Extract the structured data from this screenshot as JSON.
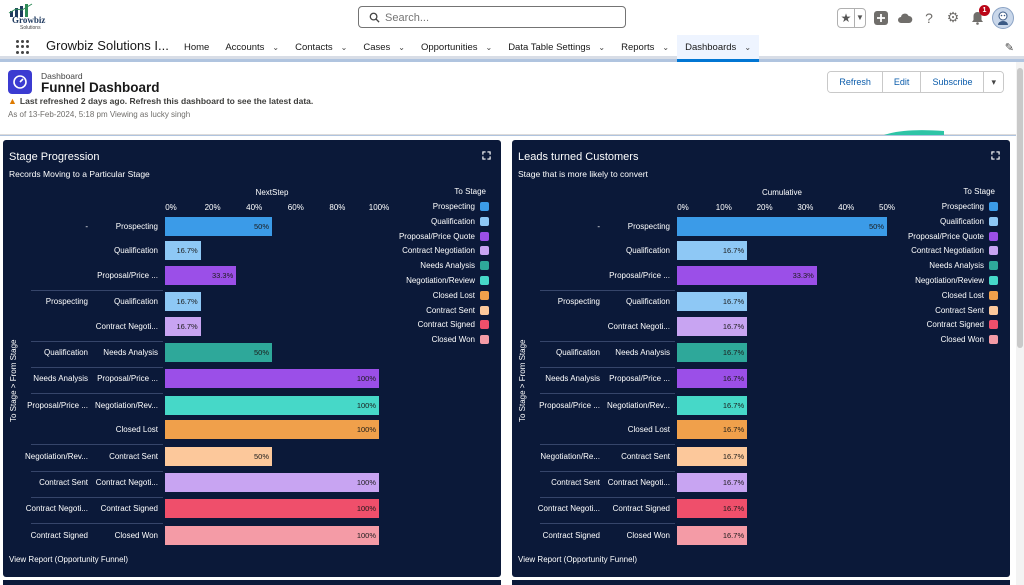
{
  "brand": {
    "logo_text": "Growbiz",
    "logo_sub": "Solutions"
  },
  "search": {
    "placeholder": "Search..."
  },
  "header_icons": {
    "notification_count": "1"
  },
  "nav": {
    "app_name": "Growbiz Solutions I...",
    "items": [
      {
        "label": "Home",
        "has_menu": false
      },
      {
        "label": "Accounts",
        "has_menu": true
      },
      {
        "label": "Contacts",
        "has_menu": true
      },
      {
        "label": "Cases",
        "has_menu": true
      },
      {
        "label": "Opportunities",
        "has_menu": true
      },
      {
        "label": "Data Table Settings",
        "has_menu": true
      },
      {
        "label": "Reports",
        "has_menu": true
      },
      {
        "label": "Dashboards",
        "has_menu": true,
        "active": true
      }
    ]
  },
  "dashboard": {
    "kind": "Dashboard",
    "title": "Funnel Dashboard",
    "warning": "Last refreshed 2 days ago. Refresh this dashboard to see the latest data.",
    "as_of": "As of 13-Feb-2024, 5:18 pm Viewing as lucky singh",
    "buttons": {
      "refresh": "Refresh",
      "edit": "Edit",
      "subscribe": "Subscribe"
    }
  },
  "colors": {
    "Prospecting": "#3b9be8",
    "Qualification": "#8ec8f5",
    "Proposal/Price Quote": "#9b4fe8",
    "Contract Negotiation": "#c8a4f2",
    "Needs Analysis": "#2ea89a",
    "Negotiation/Review": "#46d8c8",
    "Closed Lost": "#f0a04b",
    "Contract Sent": "#fcc89b",
    "Contract Signed": "#ef4f6b",
    "Closed Won": "#f49ba6"
  },
  "legend": {
    "title": "To Stage",
    "items": [
      "Prospecting",
      "Qualification",
      "Proposal/Price Quote",
      "Contract Negotiation",
      "Needs Analysis",
      "Negotiation/Review",
      "Closed Lost",
      "Contract Sent",
      "Contract Signed",
      "Closed Won"
    ]
  },
  "widgets": [
    {
      "title": "Stage Progression",
      "subtitle": "Records Moving to a Particular Stage",
      "footer": "View Report (Opportunity Funnel)",
      "chart_data": {
        "type": "bar",
        "orientation": "horizontal",
        "xlabel": "NextStep",
        "ylabel": "To Stage > From Stage",
        "xlim": [
          0,
          100
        ],
        "xticks": [
          "0%",
          "20%",
          "40%",
          "60%",
          "80%",
          "100%"
        ],
        "groups": [
          {
            "from": "-",
            "rows": [
              {
                "to": "Prospecting",
                "to_label": "Prospecting",
                "value": 50,
                "label": "50%"
              },
              {
                "to": "Qualification",
                "to_label": "Qualification",
                "value": 16.7,
                "label": "16.7%"
              },
              {
                "to": "Proposal/Price Quote",
                "to_label": "Proposal/Price ...",
                "value": 33.3,
                "label": "33.3%"
              }
            ]
          },
          {
            "from": "Prospecting",
            "rows": [
              {
                "to": "Qualification",
                "to_label": "Qualification",
                "value": 16.7,
                "label": "16.7%"
              },
              {
                "to": "Contract Negotiation",
                "to_label": "Contract Negoti...",
                "value": 16.7,
                "label": "16.7%"
              }
            ]
          },
          {
            "from": "Qualification",
            "rows": [
              {
                "to": "Needs Analysis",
                "to_label": "Needs Analysis",
                "value": 50,
                "label": "50%"
              }
            ]
          },
          {
            "from": "Needs Analysis",
            "rows": [
              {
                "to": "Proposal/Price Quote",
                "to_label": "Proposal/Price ...",
                "value": 100,
                "label": "100%"
              }
            ]
          },
          {
            "from": "Proposal/Price ...",
            "rows": [
              {
                "to": "Negotiation/Review",
                "to_label": "Negotiation/Rev...",
                "value": 100,
                "label": "100%"
              },
              {
                "to": "Closed Lost",
                "to_label": "Closed Lost",
                "value": 100,
                "label": "100%"
              }
            ]
          },
          {
            "from": "Negotiation/Rev...",
            "rows": [
              {
                "to": "Contract Sent",
                "to_label": "Contract Sent",
                "value": 50,
                "label": "50%"
              }
            ]
          },
          {
            "from": "Contract Sent",
            "rows": [
              {
                "to": "Contract Negotiation",
                "to_label": "Contract Negoti...",
                "value": 100,
                "label": "100%"
              }
            ]
          },
          {
            "from": "Contract Negoti...",
            "rows": [
              {
                "to": "Contract Signed",
                "to_label": "Contract Signed",
                "value": 100,
                "label": "100%"
              }
            ]
          },
          {
            "from": "Contract Signed",
            "rows": [
              {
                "to": "Closed Won",
                "to_label": "Closed Won",
                "value": 100,
                "label": "100%"
              }
            ]
          }
        ]
      }
    },
    {
      "title": "Leads turned Customers",
      "subtitle": "Stage that is more likely to convert",
      "footer": "View Report (Opportunity Funnel)",
      "chart_data": {
        "type": "bar",
        "orientation": "horizontal",
        "xlabel": "Cumulative",
        "ylabel": "To Stage > From Stage",
        "xlim": [
          0,
          50
        ],
        "xticks": [
          "0%",
          "10%",
          "20%",
          "30%",
          "40%",
          "50%"
        ],
        "groups": [
          {
            "from": "-",
            "rows": [
              {
                "to": "Prospecting",
                "to_label": "Prospecting",
                "value": 50,
                "label": "50%"
              },
              {
                "to": "Qualification",
                "to_label": "Qualification",
                "value": 16.7,
                "label": "16.7%"
              },
              {
                "to": "Proposal/Price Quote",
                "to_label": "Proposal/Price ...",
                "value": 33.3,
                "label": "33.3%"
              }
            ]
          },
          {
            "from": "Prospecting",
            "rows": [
              {
                "to": "Qualification",
                "to_label": "Qualification",
                "value": 16.7,
                "label": "16.7%"
              },
              {
                "to": "Contract Negotiation",
                "to_label": "Contract Negoti...",
                "value": 16.7,
                "label": "16.7%"
              }
            ]
          },
          {
            "from": "Qualification",
            "rows": [
              {
                "to": "Needs Analysis",
                "to_label": "Needs Analysis",
                "value": 16.7,
                "label": "16.7%"
              }
            ]
          },
          {
            "from": "Needs Analysis",
            "rows": [
              {
                "to": "Proposal/Price Quote",
                "to_label": "Proposal/Price ...",
                "value": 16.7,
                "label": "16.7%"
              }
            ]
          },
          {
            "from": "Proposal/Price ...",
            "rows": [
              {
                "to": "Negotiation/Review",
                "to_label": "Negotiation/Rev...",
                "value": 16.7,
                "label": "16.7%"
              },
              {
                "to": "Closed Lost",
                "to_label": "Closed Lost",
                "value": 16.7,
                "label": "16.7%"
              }
            ]
          },
          {
            "from": "Negotiation/Re...",
            "rows": [
              {
                "to": "Contract Sent",
                "to_label": "Contract Sent",
                "value": 16.7,
                "label": "16.7%"
              }
            ]
          },
          {
            "from": "Contract Sent",
            "rows": [
              {
                "to": "Contract Negotiation",
                "to_label": "Contract Negoti...",
                "value": 16.7,
                "label": "16.7%"
              }
            ]
          },
          {
            "from": "Contract Negoti...",
            "rows": [
              {
                "to": "Contract Signed",
                "to_label": "Contract Signed",
                "value": 16.7,
                "label": "16.7%"
              }
            ]
          },
          {
            "from": "Contract Signed",
            "rows": [
              {
                "to": "Closed Won",
                "to_label": "Closed Won",
                "value": 16.7,
                "label": "16.7%"
              }
            ]
          }
        ]
      }
    }
  ]
}
